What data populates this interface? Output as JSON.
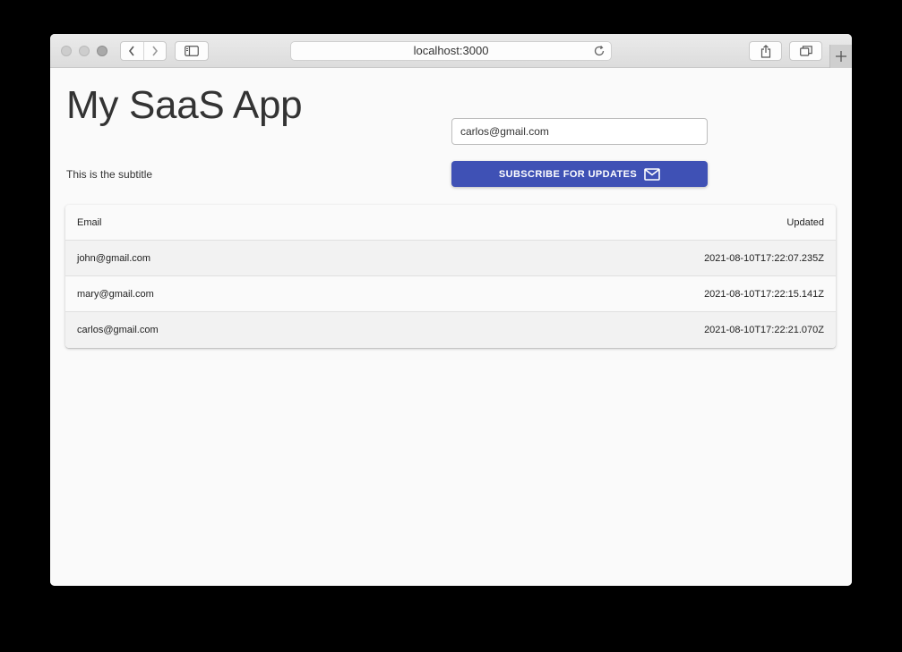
{
  "browser": {
    "url": "localhost:3000",
    "icons": {
      "back": "chevron-left-icon",
      "forward": "chevron-right-icon",
      "sidebar": "sidebar-icon",
      "reload": "reload-icon",
      "share": "share-icon",
      "tabs": "tabs-overview-icon",
      "new_tab": "plus-icon"
    }
  },
  "header": {
    "title": "My SaaS App",
    "subtitle": "This is the subtitle"
  },
  "subscribe": {
    "email_value": "carlos@gmail.com",
    "button_label": "SUBSCRIBE FOR UPDATES",
    "button_icon": "mail-icon",
    "button_color": "#3f51b5"
  },
  "table": {
    "columns": [
      "Email",
      "Updated"
    ],
    "rows": [
      {
        "email": "john@gmail.com",
        "updated": "2021-08-10T17:22:07.235Z"
      },
      {
        "email": "mary@gmail.com",
        "updated": "2021-08-10T17:22:15.141Z"
      },
      {
        "email": "carlos@gmail.com",
        "updated": "2021-08-10T17:22:21.070Z"
      }
    ]
  }
}
